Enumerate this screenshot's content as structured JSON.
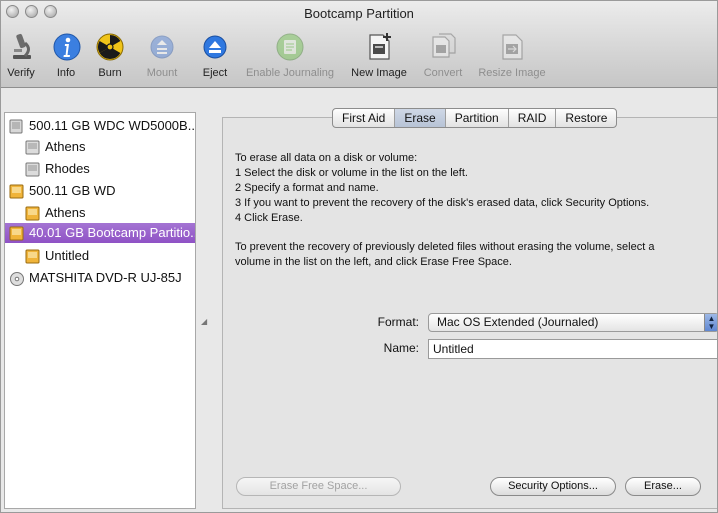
{
  "window": {
    "title": "Bootcamp Partition"
  },
  "toolbar": {
    "verify": "Verify",
    "info": "Info",
    "burn": "Burn",
    "mount": "Mount",
    "eject": "Eject",
    "enable_journaling": "Enable Journaling",
    "new_image": "New Image",
    "convert": "Convert",
    "resize_image": "Resize Image"
  },
  "sidebar": {
    "items": [
      {
        "label": "500.11 GB WDC WD5000B..."
      },
      {
        "label": "Athens"
      },
      {
        "label": "Rhodes"
      },
      {
        "label": "500.11 GB WD"
      },
      {
        "label": "Athens"
      },
      {
        "label": "40.01 GB Bootcamp Partitio..."
      },
      {
        "label": "Untitled"
      },
      {
        "label": "MATSHITA DVD-R UJ-85J"
      }
    ]
  },
  "tabs": [
    {
      "label": "First Aid"
    },
    {
      "label": "Erase"
    },
    {
      "label": "Partition"
    },
    {
      "label": "RAID"
    },
    {
      "label": "Restore"
    }
  ],
  "erase": {
    "instructions": [
      "To erase all data on a disk or volume:",
      "1 Select the disk or volume in the list on the left.",
      "2 Specify a format and name.",
      "3 If you want to prevent the recovery of the disk's erased data, click Security Options.",
      "4 Click Erase."
    ],
    "free_space_note_1": "To prevent the recovery of previously deleted files without erasing the volume, select a",
    "free_space_note_2": "volume in the list on the left, and click Erase Free Space.",
    "format_label": "Format:",
    "format_value": "Mac OS Extended (Journaled)",
    "name_label": "Name:",
    "name_value": "Untitled",
    "erase_free_space_button": "Erase Free Space...",
    "security_options_button": "Security Options...",
    "erase_button": "Erase..."
  },
  "colors": {
    "selection": "#9a62cc",
    "tab_active": "#c3cddd"
  }
}
